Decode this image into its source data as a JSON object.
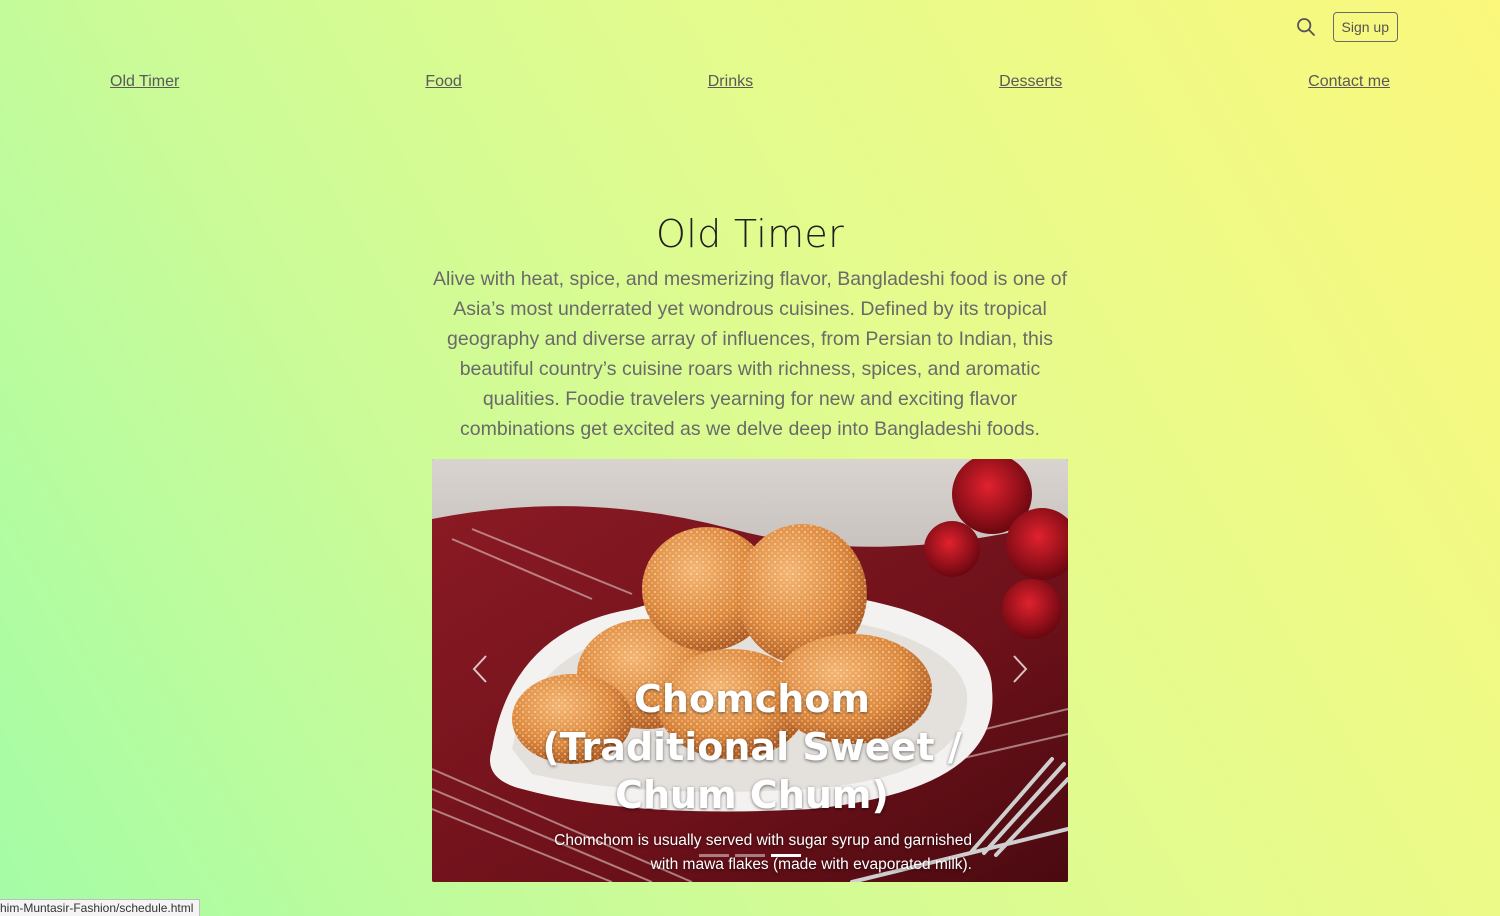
{
  "header": {
    "search_icon": "search-icon",
    "signup_label": "Sign up"
  },
  "nav": {
    "items": [
      {
        "label": "Old Timer"
      },
      {
        "label": "Food"
      },
      {
        "label": "Drinks"
      },
      {
        "label": "Desserts"
      },
      {
        "label": "Contact me"
      }
    ]
  },
  "hero": {
    "title": "Old Timer",
    "lead": "Alive with heat, spice, and mesmerizing flavor, Bangladeshi food is one of Asia’s most underrated yet wondrous cuisines. Defined by its tropical geography and diverse array of influences, from Persian to Indian, this beautiful country’s cuisine roars with richness, spices, and aromatic qualities. Foodie travelers yearning for new and exciting flavor combinations get excited as we delve deep into Bangladeshi foods."
  },
  "carousel": {
    "active_index": 2,
    "slide_count": 3,
    "prev_icon": "chevron-left-icon",
    "next_icon": "chevron-right-icon",
    "caption_title": "Chomchom (Traditional Sweet / Chum Chum)",
    "caption_text": "Chomchom is usually served with sugar syrup and garnished with mawa flakes (made with evaporated milk)."
  },
  "statusbar": {
    "url": "him-Muntasir-Fashion/schedule.html"
  },
  "colors": {
    "gradient_start": "#a4fca6",
    "gradient_end": "#fbf87c",
    "cloth_red": "#7a1420",
    "sweet_orange": "#e08a3c"
  }
}
